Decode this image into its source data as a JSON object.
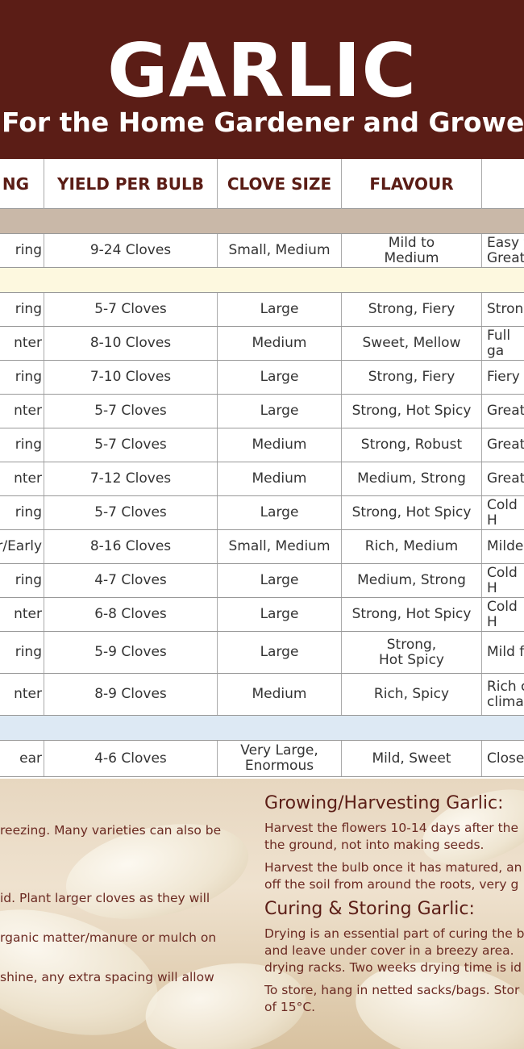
{
  "header": {
    "title": "GARLIC",
    "subtitle": "For the Home Gardener and Grower"
  },
  "table": {
    "columns": [
      "NG",
      "YIELD PER BULB",
      "CLOVE SIZE",
      "FLAVOUR",
      ""
    ],
    "rows": [
      {
        "type": "band",
        "color": "#c9b8a8"
      },
      {
        "type": "row",
        "cells": [
          "ring",
          "9-24 Cloves",
          "Small, Medium",
          "Mild to\nMedium",
          "Easy t\nGreat"
        ]
      },
      {
        "type": "band",
        "color": "#fdf8df"
      },
      {
        "type": "row",
        "cells": [
          "ring",
          "5-7 Cloves",
          "Large",
          "Strong, Fiery",
          "Stron"
        ]
      },
      {
        "type": "row",
        "cells": [
          "nter",
          "8-10 Cloves",
          "Medium",
          "Sweet, Mellow",
          "Full ga"
        ]
      },
      {
        "type": "row",
        "cells": [
          "ring",
          "7-10 Cloves",
          "Large",
          "Strong, Fiery",
          "Fiery f"
        ]
      },
      {
        "type": "row",
        "cells": [
          "nter",
          "5-7 Cloves",
          "Large",
          "Strong, Hot Spicy",
          "Great"
        ]
      },
      {
        "type": "row",
        "cells": [
          "ring",
          "5-7 Cloves",
          "Medium",
          "Strong, Robust",
          "Great"
        ]
      },
      {
        "type": "row",
        "cells": [
          "nter",
          "7-12 Cloves",
          "Medium",
          "Medium, Strong",
          "Great"
        ]
      },
      {
        "type": "row",
        "cells": [
          "ring",
          "5-7 Cloves",
          "Large",
          "Strong, Hot Spicy",
          "Cold H"
        ]
      },
      {
        "type": "row",
        "cells": [
          "er/Early",
          "8-16 Cloves",
          "Small, Medium",
          "Rich, Medium",
          "Milde"
        ]
      },
      {
        "type": "row",
        "cells": [
          "ring",
          "4-7 Cloves",
          "Large",
          "Medium, Strong",
          "Cold H"
        ]
      },
      {
        "type": "row",
        "cells": [
          "nter",
          "6-8 Cloves",
          "Large",
          "Strong, Hot Spicy",
          "Cold H"
        ]
      },
      {
        "type": "row",
        "cells": [
          "ring",
          "5-9 Cloves",
          "Large",
          "Strong,\nHot Spicy",
          "Mild f"
        ]
      },
      {
        "type": "row",
        "cells": [
          "nter",
          "8-9 Cloves",
          "Medium",
          "Rich, Spicy",
          "Rich c\nclimat"
        ]
      },
      {
        "type": "band",
        "color": "#dde9f4"
      },
      {
        "type": "row",
        "cells": [
          "ear",
          "4-6 Cloves",
          "Very Large,\nEnormous",
          "Mild, Sweet",
          "Close"
        ]
      }
    ]
  },
  "left_notes": [
    "reezing. Many varieties can also be",
    "id. Plant larger cloves as they will",
    "rganic matter/manure or mulch on",
    "shine, any extra spacing will allow"
  ],
  "growing": {
    "heading": "Growing/Harvesting Garlic:",
    "p1_l1": "Harvest the flowers 10-14 days after the",
    "p1_l2": "the ground, not into making seeds.",
    "p2_l1": "Harvest the bulb once it has matured, an",
    "p2_l2": "off the soil from around the roots, very g"
  },
  "curing": {
    "heading": "Curing & Storing Garlic:",
    "p1_l1": "Drying is an essential part of curing the b",
    "p1_l2": "and leave under cover in a breezy area.",
    "p1_l3": "drying racks. Two weeks drying time is id",
    "p2_l1": "To store, hang in netted sacks/bags. Stor",
    "p2_l2": "of 15°C."
  }
}
